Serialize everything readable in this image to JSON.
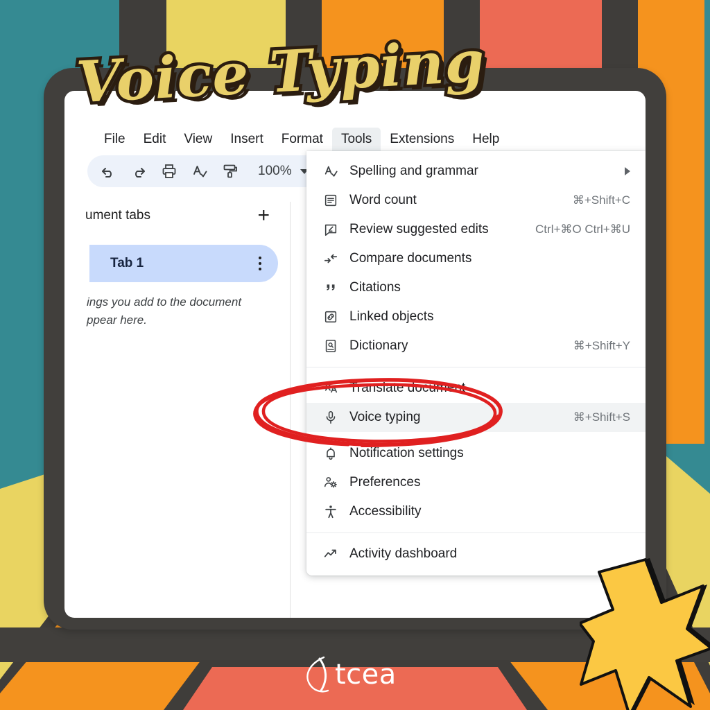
{
  "headline": {
    "text": "Voice Typing"
  },
  "brand": {
    "name": "tcea",
    "logo_icon": "tcea-swoosh-icon"
  },
  "colors": {
    "teal": "#358a92",
    "yellow": "#e9d461",
    "orange": "#f5931e",
    "coral": "#ec6a54",
    "dark": "#3f3d3a",
    "annotation_red": "#e02020",
    "star_yellow": "#fbc843",
    "menu_highlight": "#f1f3f4",
    "tab_chip": "#c8dafc",
    "toolbar_bg": "#edf2fa"
  },
  "menubar": {
    "items": [
      {
        "label": "File",
        "active": false
      },
      {
        "label": "Edit",
        "active": false
      },
      {
        "label": "View",
        "active": false
      },
      {
        "label": "Insert",
        "active": false
      },
      {
        "label": "Format",
        "active": false
      },
      {
        "label": "Tools",
        "active": true
      },
      {
        "label": "Extensions",
        "active": false
      },
      {
        "label": "Help",
        "active": false
      }
    ]
  },
  "toolbar": {
    "buttons": [
      {
        "icon": "undo-icon",
        "name": "undo-button"
      },
      {
        "icon": "redo-icon",
        "name": "redo-button"
      },
      {
        "icon": "print-icon",
        "name": "print-button"
      },
      {
        "icon": "spellcheck-icon",
        "name": "spellcheck-button"
      },
      {
        "icon": "paint-format-icon",
        "name": "paint-format-button"
      }
    ],
    "zoom_value": "100%"
  },
  "sidebar": {
    "title": "ument tabs",
    "add_label": "+",
    "tab": {
      "label": "Tab 1"
    },
    "hint_line1": "ings you add to the document",
    "hint_line2": "ppear here."
  },
  "dropdown": {
    "groups": [
      {
        "items": [
          {
            "label": "Spelling and grammar",
            "accel": "",
            "icon": "spellcheck-icon",
            "submenu": true,
            "highlighted": false
          },
          {
            "label": "Word count",
            "accel": "⌘+Shift+C",
            "icon": "word-count-icon",
            "submenu": false,
            "highlighted": false
          },
          {
            "label": "Review suggested edits",
            "accel": "Ctrl+⌘O Ctrl+⌘U",
            "icon": "review-edits-icon",
            "submenu": false,
            "highlighted": false
          },
          {
            "label": "Compare documents",
            "accel": "",
            "icon": "compare-documents-icon",
            "submenu": false,
            "highlighted": false
          },
          {
            "label": "Citations",
            "accel": "",
            "icon": "citations-icon",
            "submenu": false,
            "highlighted": false
          },
          {
            "label": "Linked objects",
            "accel": "",
            "icon": "linked-objects-icon",
            "submenu": false,
            "highlighted": false
          },
          {
            "label": "Dictionary",
            "accel": "⌘+Shift+Y",
            "icon": "dictionary-icon",
            "submenu": false,
            "highlighted": false
          }
        ]
      },
      {
        "items": [
          {
            "label": "Translate document",
            "accel": "",
            "icon": "translate-icon",
            "submenu": false,
            "highlighted": false
          },
          {
            "label": "Voice typing",
            "accel": "⌘+Shift+S",
            "icon": "microphone-icon",
            "submenu": false,
            "highlighted": true
          },
          {
            "label": "Notification settings",
            "accel": "",
            "icon": "bell-icon",
            "submenu": false,
            "highlighted": false
          },
          {
            "label": "Preferences",
            "accel": "",
            "icon": "preferences-icon",
            "submenu": false,
            "highlighted": false
          },
          {
            "label": "Accessibility",
            "accel": "",
            "icon": "accessibility-icon",
            "submenu": false,
            "highlighted": false
          }
        ]
      },
      {
        "items": [
          {
            "label": "Activity dashboard",
            "accel": "",
            "icon": "activity-dashboard-icon",
            "submenu": false,
            "highlighted": false
          }
        ]
      }
    ]
  },
  "annotation": {
    "shape": "hand-drawn-red-ellipse",
    "targets": "Voice typing"
  }
}
